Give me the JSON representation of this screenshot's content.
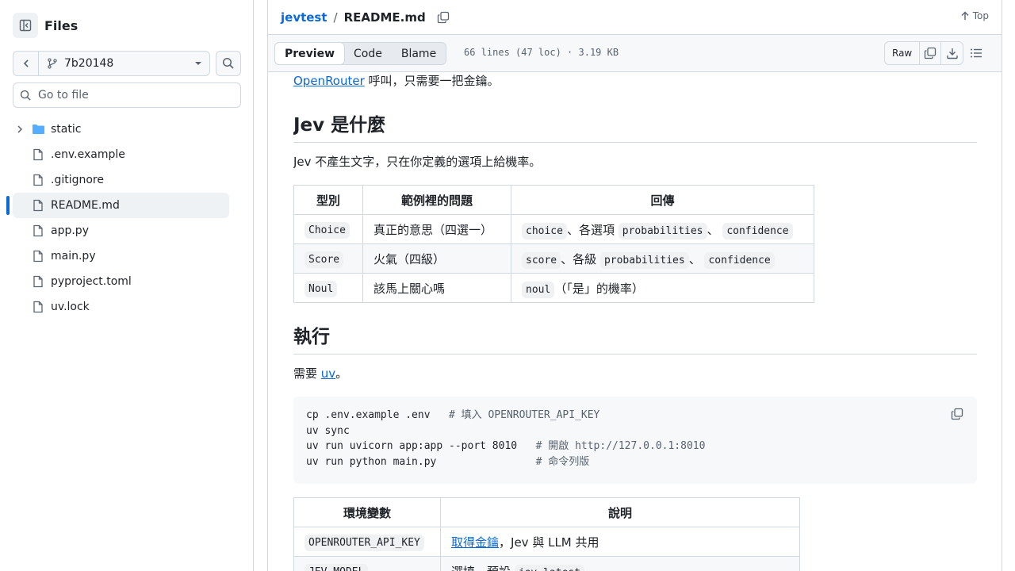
{
  "sidebar": {
    "title": "Files",
    "branch": "7b20148",
    "goto_placeholder": "Go to file",
    "items": [
      {
        "label": "static",
        "type": "folder"
      },
      {
        "label": ".env.example",
        "type": "file"
      },
      {
        "label": ".gitignore",
        "type": "file"
      },
      {
        "label": "README.md",
        "type": "file",
        "active": true
      },
      {
        "label": "app.py",
        "type": "file"
      },
      {
        "label": "main.py",
        "type": "file"
      },
      {
        "label": "pyproject.toml",
        "type": "file"
      },
      {
        "label": "uv.lock",
        "type": "file"
      }
    ]
  },
  "header": {
    "repo": "jevtest",
    "sep": "/",
    "file": "README.md",
    "top_label": "Top"
  },
  "toolbar": {
    "tabs": [
      "Preview",
      "Code",
      "Blame"
    ],
    "file_info": "66 lines (47 loc) · 3.19 KB",
    "raw_label": "Raw"
  },
  "content": {
    "intro_link": "OpenRouter",
    "intro_rest": " 呼叫，只需要一把金鑰。",
    "h_what": "Jev 是什麼",
    "p_what": "Jev 不產生文字，只在你定義的選項上給機率。",
    "table1": {
      "headers": [
        "型別",
        "範例裡的問題",
        "回傳"
      ],
      "rows": [
        {
          "type": "Choice",
          "q": "真正的意思（四選一）",
          "r1": "choice",
          "s1": "、各選項",
          "r2": "probabilities",
          "s2": "、",
          "r3": "confidence",
          "s3": ""
        },
        {
          "type": "Score",
          "q": "火氣（四級）",
          "r1": "score",
          "s1": "、各級",
          "r2": "probabilities",
          "s2": "、",
          "r3": "confidence",
          "s3": ""
        },
        {
          "type": "Noul",
          "q": "該馬上關心嗎",
          "r1": "noul",
          "s1": "（「是」的機率）",
          "r2": "",
          "s2": "",
          "r3": "",
          "s3": ""
        }
      ]
    },
    "h_run": "執行",
    "p_run_pre": "需要 ",
    "p_run_link": "uv",
    "p_run_post": "。",
    "code": [
      {
        "cmd": "cp .env.example .env   ",
        "comment": "# 填入 OPENROUTER_API_KEY"
      },
      {
        "cmd": "uv sync",
        "comment": ""
      },
      {
        "cmd": "uv run uvicorn app:app --port 8010   ",
        "comment": "# 開啟 http://127.0.0.1:8010"
      },
      {
        "cmd": "uv run python main.py                ",
        "comment": "# 命令列版"
      }
    ],
    "table2": {
      "headers": [
        "環境變數",
        "說明"
      ],
      "rows": [
        {
          "var": "OPENROUTER_API_KEY",
          "link": "取得金鑰",
          "rest": "，Jev 與 LLM 共用",
          "code": ""
        },
        {
          "var": "JEV_MODEL",
          "link": "",
          "rest": "選填，預設 ",
          "code": "jev-latest"
        }
      ]
    }
  }
}
